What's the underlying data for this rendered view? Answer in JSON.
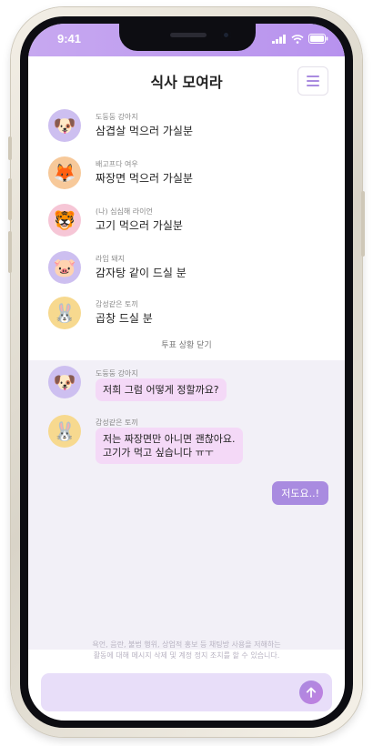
{
  "status_bar": {
    "time": "9:41"
  },
  "header": {
    "title": "식사 모여라"
  },
  "vote": {
    "items": [
      {
        "nickname": "도둥둥 강아지",
        "text": "삼겹살 먹으러 가실분",
        "avatar_icon": "dog-face-icon",
        "avatar_glyph": "🐶",
        "avatar_bg": "#cdbff0"
      },
      {
        "nickname": "배고프다 여우",
        "text": "짜장면 먹으러 가실분",
        "avatar_icon": "fox-face-icon",
        "avatar_glyph": "🦊",
        "avatar_bg": "#f7c99a"
      },
      {
        "nickname": "(나) 심심해 라이언",
        "text": "고기 먹으러 가실분",
        "avatar_icon": "tiger-face-icon",
        "avatar_glyph": "🐯",
        "avatar_bg": "#f6c6d6"
      },
      {
        "nickname": "라임 돼지",
        "text": "감자탕 같이 드실 분",
        "avatar_icon": "pig-face-icon",
        "avatar_glyph": "🐷",
        "avatar_bg": "#cdbff0"
      },
      {
        "nickname": "감성같은 토끼",
        "text": "곱창 드실 분",
        "avatar_icon": "rabbit-face-icon",
        "avatar_glyph": "🐰",
        "avatar_bg": "#f7d98f"
      }
    ],
    "close_label": "투표 상황 닫기"
  },
  "chat": {
    "messages": [
      {
        "nickname": "도둥둥 강아지",
        "avatar_icon": "dog-face-icon",
        "avatar_glyph": "🐶",
        "avatar_bg": "#cdbff0",
        "lines": [
          "저희 그럼 어떻게 정할까요?"
        ]
      },
      {
        "nickname": "감성같은 토끼",
        "avatar_icon": "rabbit-face-icon",
        "avatar_glyph": "🐰",
        "avatar_bg": "#f7d98f",
        "lines": [
          "저는 짜장면만 아니면 괜찮아요.",
          "고기가 먹고 싶습니다 ㅠㅜ"
        ]
      }
    ],
    "my_message": "저도요..!"
  },
  "notice": {
    "line1": "욕언, 음란, 불법 행위, 상업적 홍보 등 채팅방 사용을 저해하는",
    "line2": "활동에 대해 메시지 삭제 및 계정 정지 조치를 할 수 있습니다."
  },
  "composer": {
    "placeholder": ""
  },
  "colors": {
    "accent": "#a98be0",
    "bubble": "#f4d9f7",
    "chat_bg": "#f2f0f7",
    "composer_bg": "#e8def9"
  }
}
